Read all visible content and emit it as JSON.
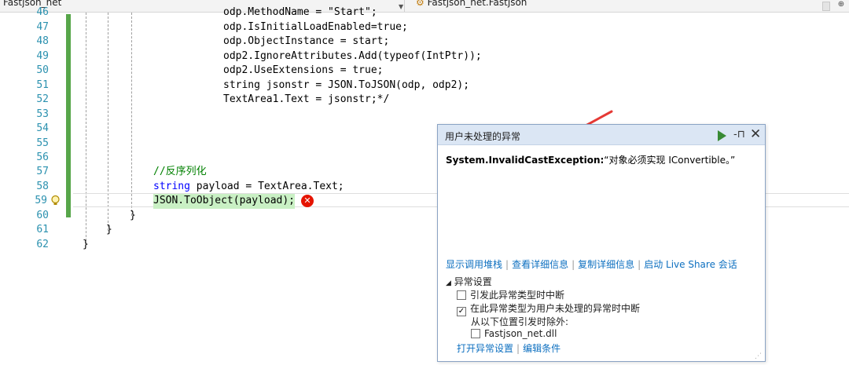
{
  "navbar": {
    "left_combo": "Fastjson_net",
    "right_combo": "Fastjson_net.Fastjson"
  },
  "editor": {
    "lines": [
      {
        "n": "46",
        "code": "odp.MethodName = \"Start\";"
      },
      {
        "n": "47",
        "code": "odp.IsInitialLoadEnabled=true;"
      },
      {
        "n": "48",
        "code": "odp.ObjectInstance = start;"
      },
      {
        "n": "49",
        "code": "odp2.IgnoreAttributes.Add(typeof(IntPtr));"
      },
      {
        "n": "50",
        "code": "odp2.UseExtensions = true;"
      },
      {
        "n": "51",
        "code": "string jsonstr = JSON.ToJSON(odp, odp2);"
      },
      {
        "n": "52",
        "code": "TextArea1.Text = jsonstr;*/"
      },
      {
        "n": "53",
        "code": ""
      },
      {
        "n": "54",
        "code": ""
      },
      {
        "n": "55",
        "code": ""
      },
      {
        "n": "56",
        "code": ""
      },
      {
        "n": "57",
        "code": "//反序列化"
      },
      {
        "n": "58",
        "code": "string payload = TextArea.Text;"
      },
      {
        "n": "59",
        "code": "JSON.ToObject(payload);"
      },
      {
        "n": "60",
        "code": "}"
      },
      {
        "n": "61",
        "code": "}"
      },
      {
        "n": "62",
        "code": "}"
      }
    ]
  },
  "popup": {
    "title": "用户未处理的异常",
    "exception_type": "System.InvalidCastException:",
    "exception_message": "“对象必须实现 IConvertible。”",
    "links": [
      "显示调用堆栈",
      "查看详细信息",
      "复制详细信息",
      "启动 Live Share 会话"
    ],
    "settings_header": "异常设置",
    "option_break_thrown": "引发此异常类型时中断",
    "option_break_unhandled": "在此异常类型为用户未处理的异常时中断",
    "except_from": "从以下位置引发时除外:",
    "module": "Fastjson_net.dll",
    "footer_links": [
      "打开异常设置",
      "编辑条件"
    ]
  },
  "colors": {
    "keyword": "#0000ff",
    "comment": "#008000",
    "line_number": "#2b91af",
    "link": "#0e70c0",
    "error": "#e51400",
    "annotation_arrow": "#e53935"
  }
}
